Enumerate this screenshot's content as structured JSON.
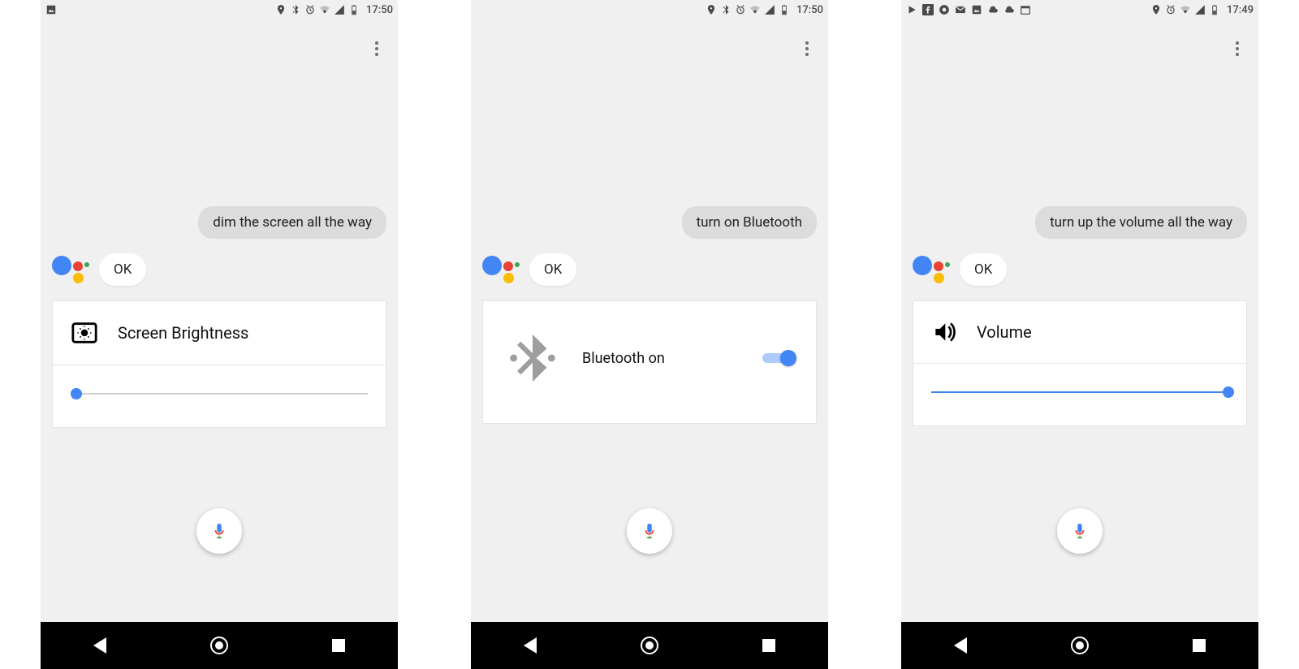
{
  "colors": {
    "accent": "#4285F4",
    "toggle_track": "#aecbfa",
    "user_bubble": "#dcdcdc"
  },
  "screens": [
    {
      "statusbar": {
        "left_icons": [
          "image-icon"
        ],
        "right_icons": [
          "location-icon",
          "bluetooth-icon",
          "alarm-icon",
          "wifi-icon",
          "signal-icon",
          "battery-icon"
        ],
        "time": "17:50"
      },
      "user_query": "dim the screen all the way",
      "assistant_reply": "OK",
      "card": {
        "type": "slider",
        "icon": "brightness-icon",
        "title": "Screen Brightness",
        "slider_percent": 2
      }
    },
    {
      "statusbar": {
        "left_icons": [],
        "right_icons": [
          "location-icon",
          "bluetooth-icon",
          "alarm-icon",
          "wifi-icon",
          "signal-icon",
          "battery-icon"
        ],
        "time": "17:50"
      },
      "user_query": "turn on Bluetooth",
      "assistant_reply": "OK",
      "card": {
        "type": "toggle",
        "icon": "bluetooth-large-icon",
        "title": "Bluetooth on",
        "toggle_on": true
      }
    },
    {
      "statusbar": {
        "left_icons": [
          "play-icon",
          "facebook-icon",
          "chrome-icon",
          "gmail-icon",
          "image-icon",
          "cloud-icon",
          "cloud-icon",
          "calendar-icon"
        ],
        "right_icons": [
          "location-icon",
          "alarm-icon",
          "wifi-icon",
          "signal-icon",
          "battery-icon"
        ],
        "time": "17:49"
      },
      "user_query": "turn up the volume all the way",
      "assistant_reply": "OK",
      "card": {
        "type": "slider",
        "icon": "volume-icon",
        "title": "Volume",
        "slider_percent": 100
      }
    }
  ],
  "nav": {
    "back": "back",
    "home": "home",
    "recent": "recent"
  }
}
